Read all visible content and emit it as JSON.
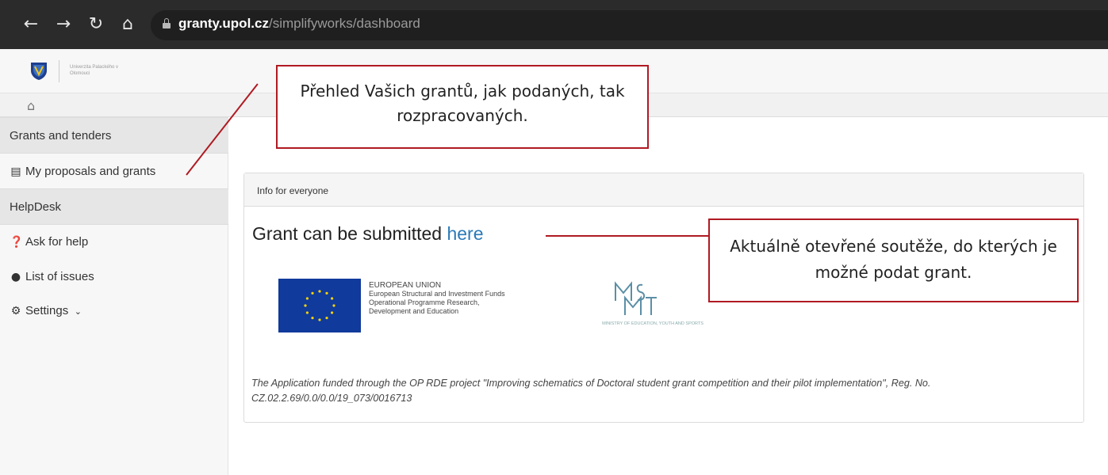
{
  "browser": {
    "back_icon": "arrow-left-icon",
    "forward_icon": "arrow-right-icon",
    "reload_icon": "reload-icon",
    "home_icon": "home-icon",
    "url_host": "granty.upol.cz",
    "url_path": "/simplifyworks/dashboard"
  },
  "header": {
    "logo_text": "Univerzita Palackého v Olomouci"
  },
  "sidebar": {
    "sections": [
      {
        "label": "Grants and tenders"
      },
      {
        "label": "HelpDesk"
      }
    ],
    "items": [
      {
        "label": "My proposals and grants",
        "icon": "file-icon"
      },
      {
        "label": "Ask for help",
        "icon": "question-circle-icon"
      },
      {
        "label": "List of issues",
        "icon": "comment-icon"
      },
      {
        "label": "Settings",
        "icon": "gear-icon"
      }
    ]
  },
  "panel": {
    "title": "Info for everyone",
    "heading_prefix": "Grant can be submitted",
    "heading_link": "here",
    "eu": {
      "line1": "EUROPEAN UNION",
      "line2": "European Structural and Investment Funds",
      "line3": "Operational Programme Research,",
      "line4": "Development and Education"
    },
    "msmt_text": "MINISTRY OF EDUCATION, YOUTH AND SPORTS",
    "funding_note": "The Application funded through the OP RDE project \"Improving schematics of Doctoral student grant competition and their pilot implementation\", Reg. No. CZ.02.2.69/0.0/0.0/19_073/0016713"
  },
  "callouts": {
    "proposals": "Přehled Vašich grantů, jak podaných, tak rozpracovaných.",
    "open_calls": "Aktuálně otevřené soutěže, do kterých je možné podat grant."
  },
  "colors": {
    "callout_border": "#b01a22",
    "link": "#2a7ab8",
    "eu_blue": "#103a9b"
  }
}
